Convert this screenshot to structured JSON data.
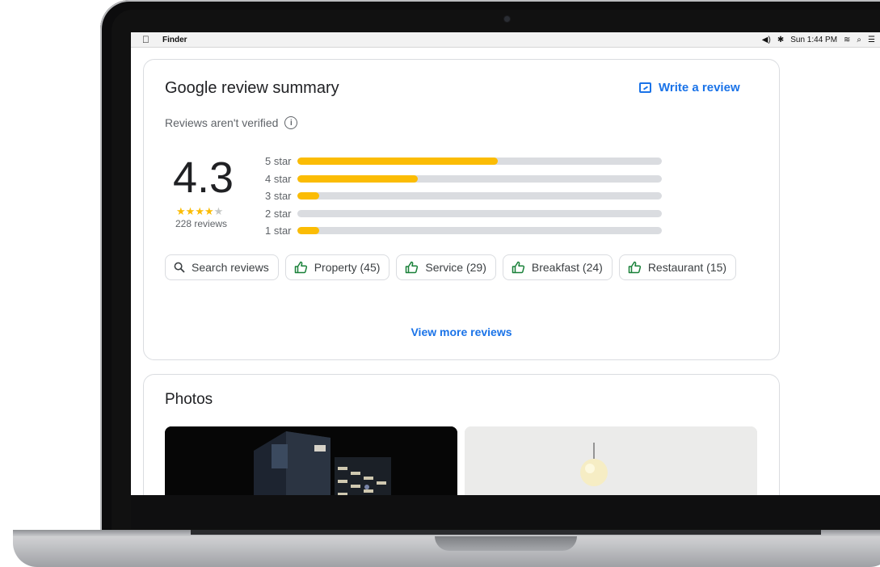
{
  "menubar": {
    "app": "Finder",
    "status_items": [
      "◀︎)",
      "✱",
      "Sun 1:44 PM",
      "≋",
      "⌕",
      "☰"
    ]
  },
  "review_summary": {
    "title": "Google review summary",
    "write_review_label": "Write a review",
    "not_verified_text": "Reviews aren't verified",
    "rating": "4.3",
    "stars_filled": 4,
    "stars_total": 5,
    "review_count_text": "228 reviews",
    "distribution": [
      {
        "label": "5 star",
        "fraction": 0.55
      },
      {
        "label": "4 star",
        "fraction": 0.33
      },
      {
        "label": "3 star",
        "fraction": 0.06
      },
      {
        "label": "2 star",
        "fraction": 0.0
      },
      {
        "label": "1 star",
        "fraction": 0.06
      }
    ],
    "chips": [
      {
        "label": "Search reviews",
        "icon": "search-icon"
      },
      {
        "label": "Property (45)",
        "icon": "thumbs-up-icon"
      },
      {
        "label": "Service (29)",
        "icon": "thumbs-up-icon"
      },
      {
        "label": "Breakfast (24)",
        "icon": "thumbs-up-icon"
      },
      {
        "label": "Restaurant (15)",
        "icon": "thumbs-up-icon"
      }
    ],
    "view_more_label": "View more reviews"
  },
  "photos": {
    "title": "Photos"
  },
  "colors": {
    "accent": "#1a73e8",
    "star": "#fbbc04",
    "chip_icon": "#188038",
    "bar_track": "#dadce0"
  }
}
